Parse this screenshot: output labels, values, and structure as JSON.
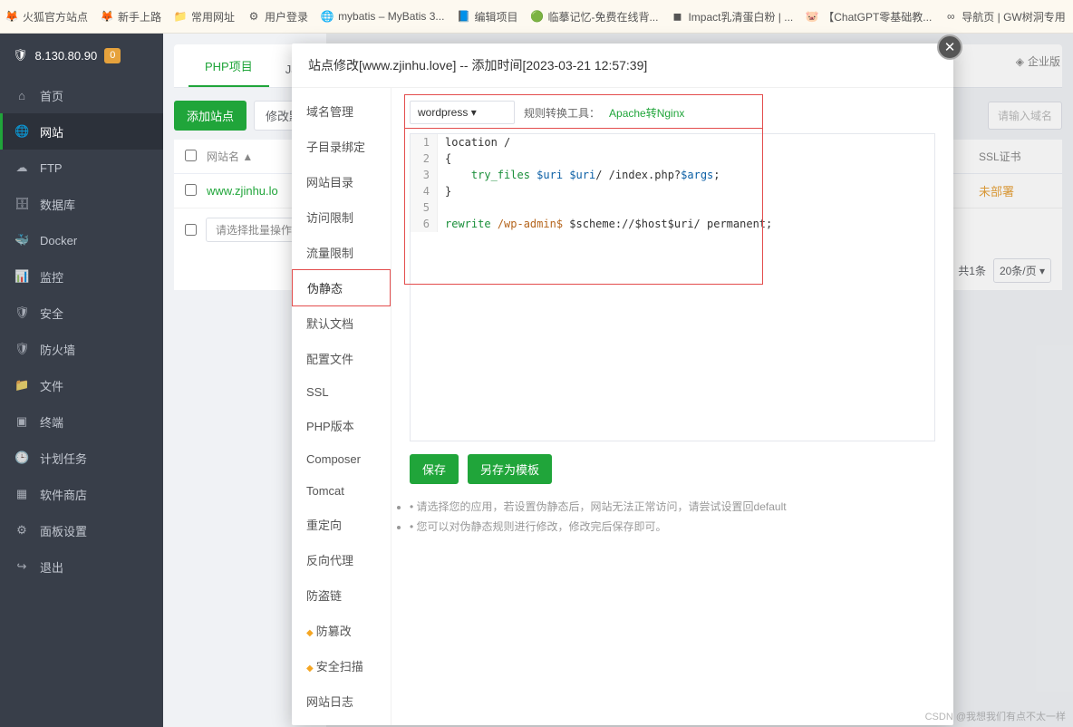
{
  "bookmarks": [
    {
      "label": "火狐官方站点",
      "icon": "🦊"
    },
    {
      "label": "新手上路",
      "icon": "🦊"
    },
    {
      "label": "常用网址",
      "icon": "📁"
    },
    {
      "label": "用户登录",
      "icon": "⚙"
    },
    {
      "label": "mybatis – MyBatis 3...",
      "icon": "🌐"
    },
    {
      "label": "编辑项目",
      "icon": "📘"
    },
    {
      "label": "临摹记忆-免费在线背...",
      "icon": "🟢"
    },
    {
      "label": "Impact乳清蛋白粉 | ...",
      "icon": "◼"
    },
    {
      "label": "【ChatGPT零基础教...",
      "icon": "🐷"
    },
    {
      "label": "导航页 | GW树洞专用",
      "icon": "∞"
    }
  ],
  "server_ip": "8.130.80.90",
  "notice_count": "0",
  "sidebar": [
    {
      "label": "首页",
      "icon": "⌂"
    },
    {
      "label": "网站",
      "icon": "🌐",
      "active": true
    },
    {
      "label": "FTP",
      "icon": "☁"
    },
    {
      "label": "数据库",
      "icon": "🗄"
    },
    {
      "label": "Docker",
      "icon": "🐳"
    },
    {
      "label": "监控",
      "icon": "📊"
    },
    {
      "label": "安全",
      "icon": "🛡"
    },
    {
      "label": "防火墙",
      "icon": "🛡"
    },
    {
      "label": "文件",
      "icon": "📁"
    },
    {
      "label": "终端",
      "icon": "▣"
    },
    {
      "label": "计划任务",
      "icon": "🕒"
    },
    {
      "label": "软件商店",
      "icon": "▦"
    },
    {
      "label": "面板设置",
      "icon": "⚙"
    },
    {
      "label": "退出",
      "icon": "↪"
    }
  ],
  "tabs": [
    {
      "label": "PHP项目",
      "active": true
    },
    {
      "label": "Ja"
    }
  ],
  "enterprise": "企业版",
  "toolbar": {
    "add": "添加站点",
    "edit": "修改默",
    "search_ph": "请输入域名"
  },
  "table": {
    "head": {
      "name": "网站名 ▲",
      "ssl": "SSL证书"
    },
    "rows": [
      {
        "name": "www.zjinhu.lo",
        "ssl": "未部署"
      }
    ]
  },
  "batch_ph": "请选择批量操作",
  "pager": {
    "total": "共1条",
    "per": "20条/页"
  },
  "modal": {
    "title": "站点修改[www.zjinhu.love] -- 添加时间[2023-03-21 12:57:39]",
    "nav": [
      {
        "label": "域名管理"
      },
      {
        "label": "子目录绑定"
      },
      {
        "label": "网站目录"
      },
      {
        "label": "访问限制"
      },
      {
        "label": "流量限制"
      },
      {
        "label": "伪静态",
        "active": true
      },
      {
        "label": "默认文档"
      },
      {
        "label": "配置文件"
      },
      {
        "label": "SSL"
      },
      {
        "label": "PHP版本"
      },
      {
        "label": "Composer"
      },
      {
        "label": "Tomcat"
      },
      {
        "label": "重定向"
      },
      {
        "label": "反向代理"
      },
      {
        "label": "防盗链"
      },
      {
        "label": "防篡改",
        "dia": true
      },
      {
        "label": "安全扫描",
        "dia": true
      },
      {
        "label": "网站日志"
      }
    ],
    "select": "wordpress",
    "hint_label": "规则转换工具：",
    "hint_link": "Apache转Nginx",
    "code": [
      {
        "n": "1",
        "html": "location /"
      },
      {
        "n": "2",
        "html": "{"
      },
      {
        "n": "3",
        "html": "    <span class='kw-green'>try_files</span> <span class='kw-var'>$uri</span> <span class='kw-var'>$uri</span>/ /index.php?<span class='kw-var'>$args</span>;"
      },
      {
        "n": "4",
        "html": "}"
      },
      {
        "n": "5",
        "html": ""
      },
      {
        "n": "6",
        "html": "<span class='kw-green'>rewrite</span> <span class='kw-orange'>/wp-admin$</span> $scheme://$host$uri/ permanent;"
      }
    ],
    "btn_save": "保存",
    "btn_tpl": "另存为模板",
    "tips": [
      "请选择您的应用，若设置伪静态后，网站无法正常访问，请尝试设置回default",
      "您可以对伪静态规则进行修改，修改完后保存即可。"
    ]
  },
  "watermark": "CSDN @我想我们有点不太一样"
}
